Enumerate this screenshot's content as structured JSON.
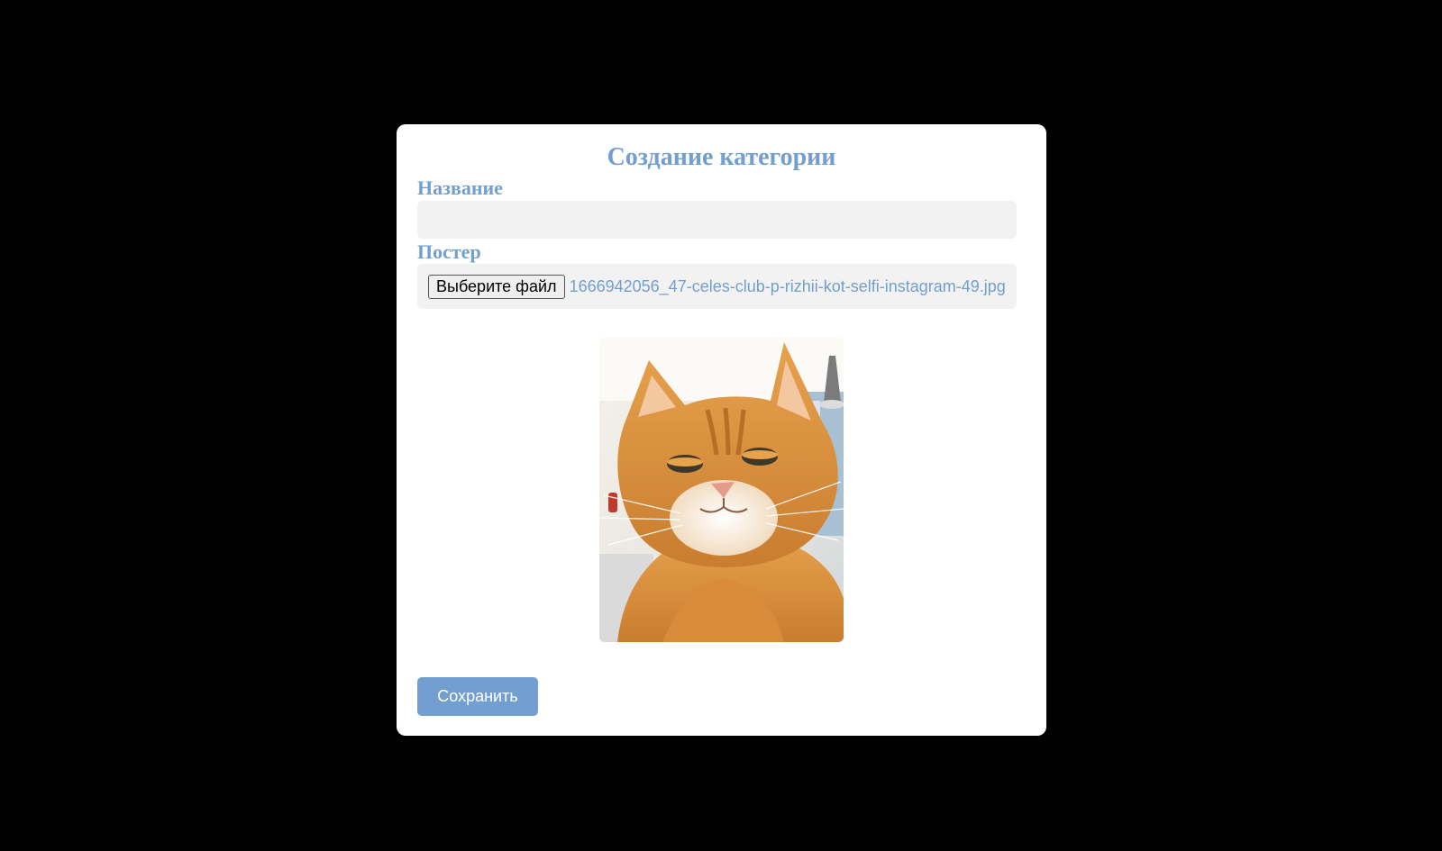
{
  "modal": {
    "title": "Создание категории",
    "name_label": "Название",
    "name_value": "",
    "poster_label": "Постер",
    "file_button_label": "Выберите файл",
    "file_name": "1666942056_47-celes-club-p-rizhii-kot-selfi-instagram-49.jpg",
    "preview_icon": "cat-photo",
    "save_label": "Сохранить"
  },
  "colors": {
    "accent": "#729fcf",
    "backdrop": "#000000",
    "input_bg": "#f2f2f2"
  }
}
